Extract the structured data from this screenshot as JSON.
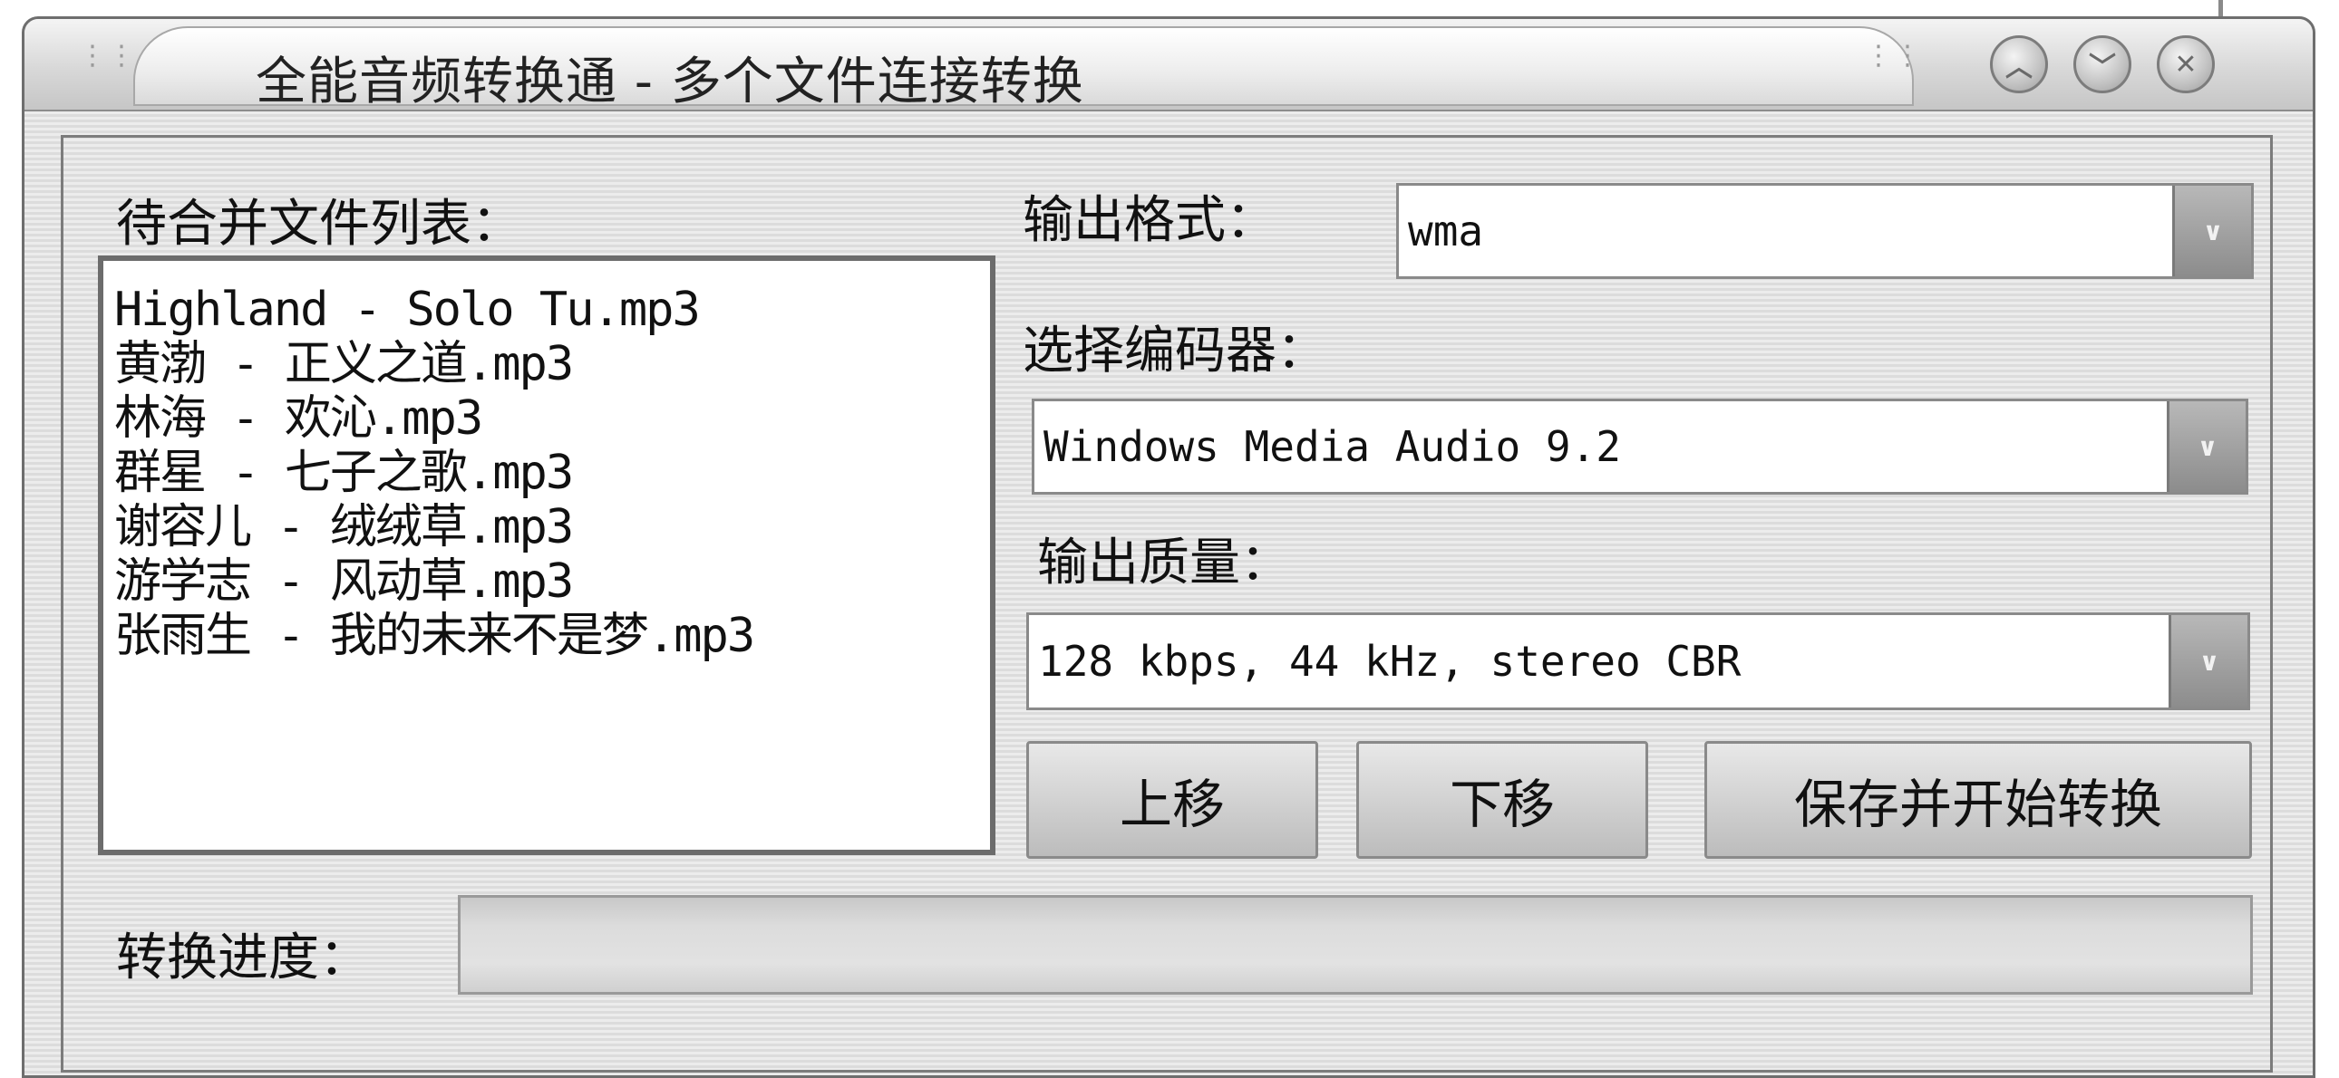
{
  "window": {
    "title": "全能音频转换通 - 多个文件连接转换",
    "controls": [
      "minimize",
      "maximize",
      "close"
    ]
  },
  "merge_list": {
    "label": "待合并文件列表：",
    "items": [
      "Highland - Solo Tu.mp3",
      "黄渤 - 正义之道.mp3",
      "林海 - 欢沁.mp3",
      "群星 - 七子之歌.mp3",
      "谢容儿 - 绒绒草.mp3",
      "游学志 - 风动草.mp3",
      "张雨生 - 我的未来不是梦.mp3"
    ]
  },
  "output_format": {
    "label": "输出格式：",
    "value": "wma"
  },
  "encoder": {
    "label": "选择编码器：",
    "value": "Windows Media Audio 9.2"
  },
  "quality": {
    "label": "输出质量：",
    "value": "128 kbps, 44 kHz, stereo CBR"
  },
  "buttons": {
    "move_up": "上移",
    "move_down": "下移",
    "save_and_convert": "保存并开始转换"
  },
  "progress": {
    "label": "转换进度：",
    "fraction": 0
  },
  "icons": {
    "minimize": "circle-up-chevron-icon",
    "maximize": "circle-down-chevron-icon",
    "close": "circle-x-icon",
    "dropdown": "chevron-down-icon"
  }
}
